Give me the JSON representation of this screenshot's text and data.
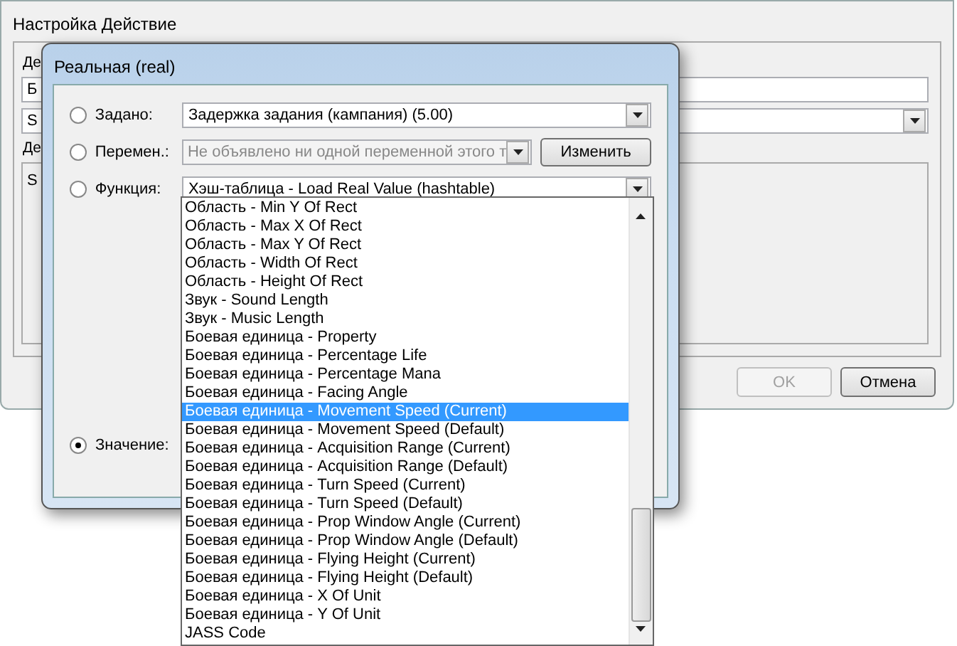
{
  "background_window": {
    "title": "Настройка Действие",
    "label_1": "Де",
    "field_1": "Б",
    "combo": "S",
    "label_2": "Де",
    "text_area": "S",
    "buttons": [
      {
        "label": "OK",
        "disabled": true
      },
      {
        "label": "Отмена",
        "disabled": false
      }
    ]
  },
  "dialog": {
    "title": "Реальная (real)",
    "options": [
      {
        "kind": "combo",
        "label": "Задано:",
        "selected": false,
        "value": "Задержка задания (кампания) (5.00)",
        "disabled": false
      },
      {
        "kind": "combo-button",
        "label": "Перемен.:",
        "selected": false,
        "value": "Не объявлено ни одной переменной этого т",
        "disabled": true,
        "button": "Изменить"
      },
      {
        "kind": "combo",
        "label": "Функция:",
        "selected": false,
        "value": "Хэш-таблица - Load Real Value (hashtable)",
        "disabled": false
      },
      {
        "kind": "field",
        "label": "Значение:",
        "selected": true
      }
    ]
  },
  "dropdown": {
    "items": [
      {
        "label": "Область - Min Y Of Rect",
        "selected": false
      },
      {
        "label": "Область - Max X Of Rect",
        "selected": false
      },
      {
        "label": "Область - Max Y Of Rect",
        "selected": false
      },
      {
        "label": "Область - Width Of Rect",
        "selected": false
      },
      {
        "label": "Область - Height Of Rect",
        "selected": false
      },
      {
        "label": "Звук - Sound Length",
        "selected": false
      },
      {
        "label": "Звук - Music Length",
        "selected": false
      },
      {
        "label": "Боевая единица - Property",
        "selected": false
      },
      {
        "label": "Боевая единица - Percentage Life",
        "selected": false
      },
      {
        "label": "Боевая единица - Percentage Mana",
        "selected": false
      },
      {
        "label": "Боевая единица - Facing Angle",
        "selected": false
      },
      {
        "label": "Боевая единица - Movement Speed (Current)",
        "selected": true
      },
      {
        "label": "Боевая единица - Movement Speed (Default)",
        "selected": false
      },
      {
        "label": "Боевая единица - Acquisition Range (Current)",
        "selected": false
      },
      {
        "label": "Боевая единица - Acquisition Range (Default)",
        "selected": false
      },
      {
        "label": "Боевая единица - Turn Speed (Current)",
        "selected": false
      },
      {
        "label": "Боевая единица - Turn Speed (Default)",
        "selected": false
      },
      {
        "label": "Боевая единица - Prop Window Angle (Current)",
        "selected": false
      },
      {
        "label": "Боевая единица - Prop Window Angle (Default)",
        "selected": false
      },
      {
        "label": "Боевая единица - Flying Height (Current)",
        "selected": false
      },
      {
        "label": "Боевая единица - Flying Height (Default)",
        "selected": false
      },
      {
        "label": "Боевая единица - X Of Unit",
        "selected": false
      },
      {
        "label": "Боевая единица - Y Of Unit",
        "selected": false
      },
      {
        "label": "JASS Code",
        "selected": false
      }
    ]
  }
}
